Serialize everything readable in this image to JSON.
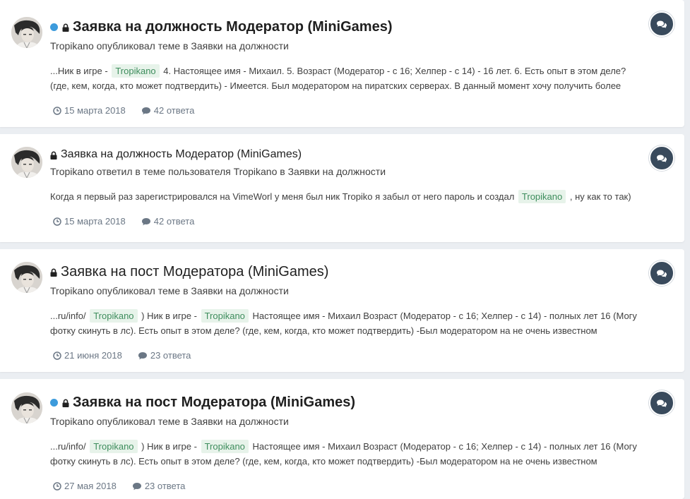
{
  "results": [
    {
      "unread": true,
      "locked": true,
      "title": "Заявка на должность Модератор (MiniGames)",
      "title_style": "bold",
      "subline_text": "Tropikano опубликовал теме в Заявки на должности",
      "snippet_parts": [
        {
          "text": "...Ник в игре - "
        },
        {
          "hl": "Tropikano"
        },
        {
          "text": " 4. Настоящее имя - Михаил. 5. Возраст (Модератор - с 16; Хелпер - с 14) - 16 лет. 6. Есть опыт в этом деле? (где, кем, когда, кто может подтвердить) - Имеется. Был модератором на пиратских серверах. В данный момент хочу получить более"
        }
      ],
      "date": "15 марта 2018",
      "replies": "42 ответа",
      "type_icon": "comments-icon"
    },
    {
      "unread": false,
      "locked": true,
      "title": "Заявка на должность Модератор (MiniGames)",
      "title_style": "normal-sm",
      "subline_text": "Tropikano ответил в теме пользователя Tropikano в Заявки на должности",
      "snippet_parts": [
        {
          "text": "Когда я первый раз зарегистрировался на VimeWorl у меня был ник Tropiko я забыл от него пароль и создал "
        },
        {
          "hl": "Tropikano"
        },
        {
          "text": " , ну как то так)"
        }
      ],
      "date": "15 марта 2018",
      "replies": "42 ответа",
      "type_icon": "comments-icon"
    },
    {
      "unread": false,
      "locked": true,
      "title": "Заявка на пост Модератора (MiniGames)",
      "title_style": "normal-lg",
      "subline_text": "Tropikano опубликовал теме в Заявки на должности",
      "snippet_parts": [
        {
          "text": "...ru/info/ "
        },
        {
          "hl": "Tropikano"
        },
        {
          "text": " ) Ник в игре - "
        },
        {
          "hl": "Tropikano"
        },
        {
          "text": " Настоящее имя - Михаил Возраст (Модератор - с 16; Хелпер - с 14) - полных лет 16 (Могу фотку скинуть в лс). Есть опыт в этом деле? (где, кем, когда, кто может подтвердить) -Был модератором на не очень известном"
        }
      ],
      "date": "21 июня 2018",
      "replies": "23 ответа",
      "type_icon": "comments-icon"
    },
    {
      "unread": true,
      "locked": true,
      "title": "Заявка на пост Модератора (MiniGames)",
      "title_style": "bold",
      "subline_text": "Tropikano опубликовал теме в Заявки на должности",
      "snippet_parts": [
        {
          "text": "...ru/info/ "
        },
        {
          "hl": "Tropikano"
        },
        {
          "text": " ) Ник в игре - "
        },
        {
          "hl": "Tropikano"
        },
        {
          "text": " Настоящее имя - Михаил Возраст (Модератор - с 16; Хелпер - с 14) - полных лет 16 (Могу фотку скинуть в лс). Есть опыт в этом деле? (где, кем, когда, кто может подтвердить) -Был модератором на не очень известном"
        }
      ],
      "date": "27 мая 2018",
      "replies": "23 ответа",
      "type_icon": "comments-icon"
    }
  ],
  "colors": {
    "unread_dot": "#3d9bdc",
    "highlight_bg": "#e7f3ea",
    "highlight_text": "#3e8d5d",
    "badge_bg": "#394a5c"
  }
}
